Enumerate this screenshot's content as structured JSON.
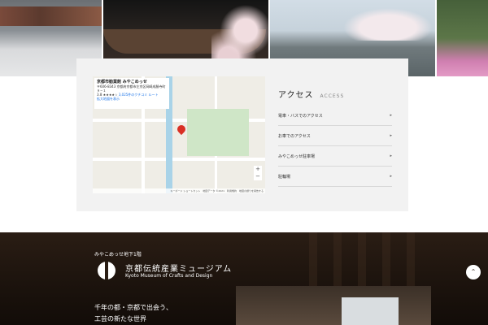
{
  "map": {
    "place_name": "京都市勧業館 みやこめっせ",
    "address": "〒606-8343 京都府京都市左京区岡崎成勝寺町９−１",
    "rating": "3.8",
    "review_count": "3,025件のクチコミ",
    "route_label": "ルート",
    "enlarge_label": "拡大地図を表示",
    "zoom_in": "+",
    "zoom_out": "−",
    "footer": "キーボード ショートカット　地図データ ©2021　利用規約　地図の誤りを報告する"
  },
  "access": {
    "title": "アクセス",
    "title_en": "ACCESS",
    "items": [
      {
        "label": "電車・バスでのアクセス",
        "arrow": "▸"
      },
      {
        "label": "お車でのアクセス",
        "arrow": "▸"
      },
      {
        "label": "みやこめっせ駐車場",
        "arrow": "▸"
      },
      {
        "label": "駐輪場",
        "arrow": "▸"
      }
    ]
  },
  "museum": {
    "floor_label": "みやこめっせ地下1階",
    "name_ja": "京都伝統産業ミュージアム",
    "name_en": "Kyoto Museum of Crafts and Design",
    "tagline_line1": "千年の都・京都で出会う、",
    "tagline_line2": "工芸の新たな世界"
  },
  "scroll_top": {
    "icon": "chevron-up-icon",
    "glyph": "⌃"
  }
}
